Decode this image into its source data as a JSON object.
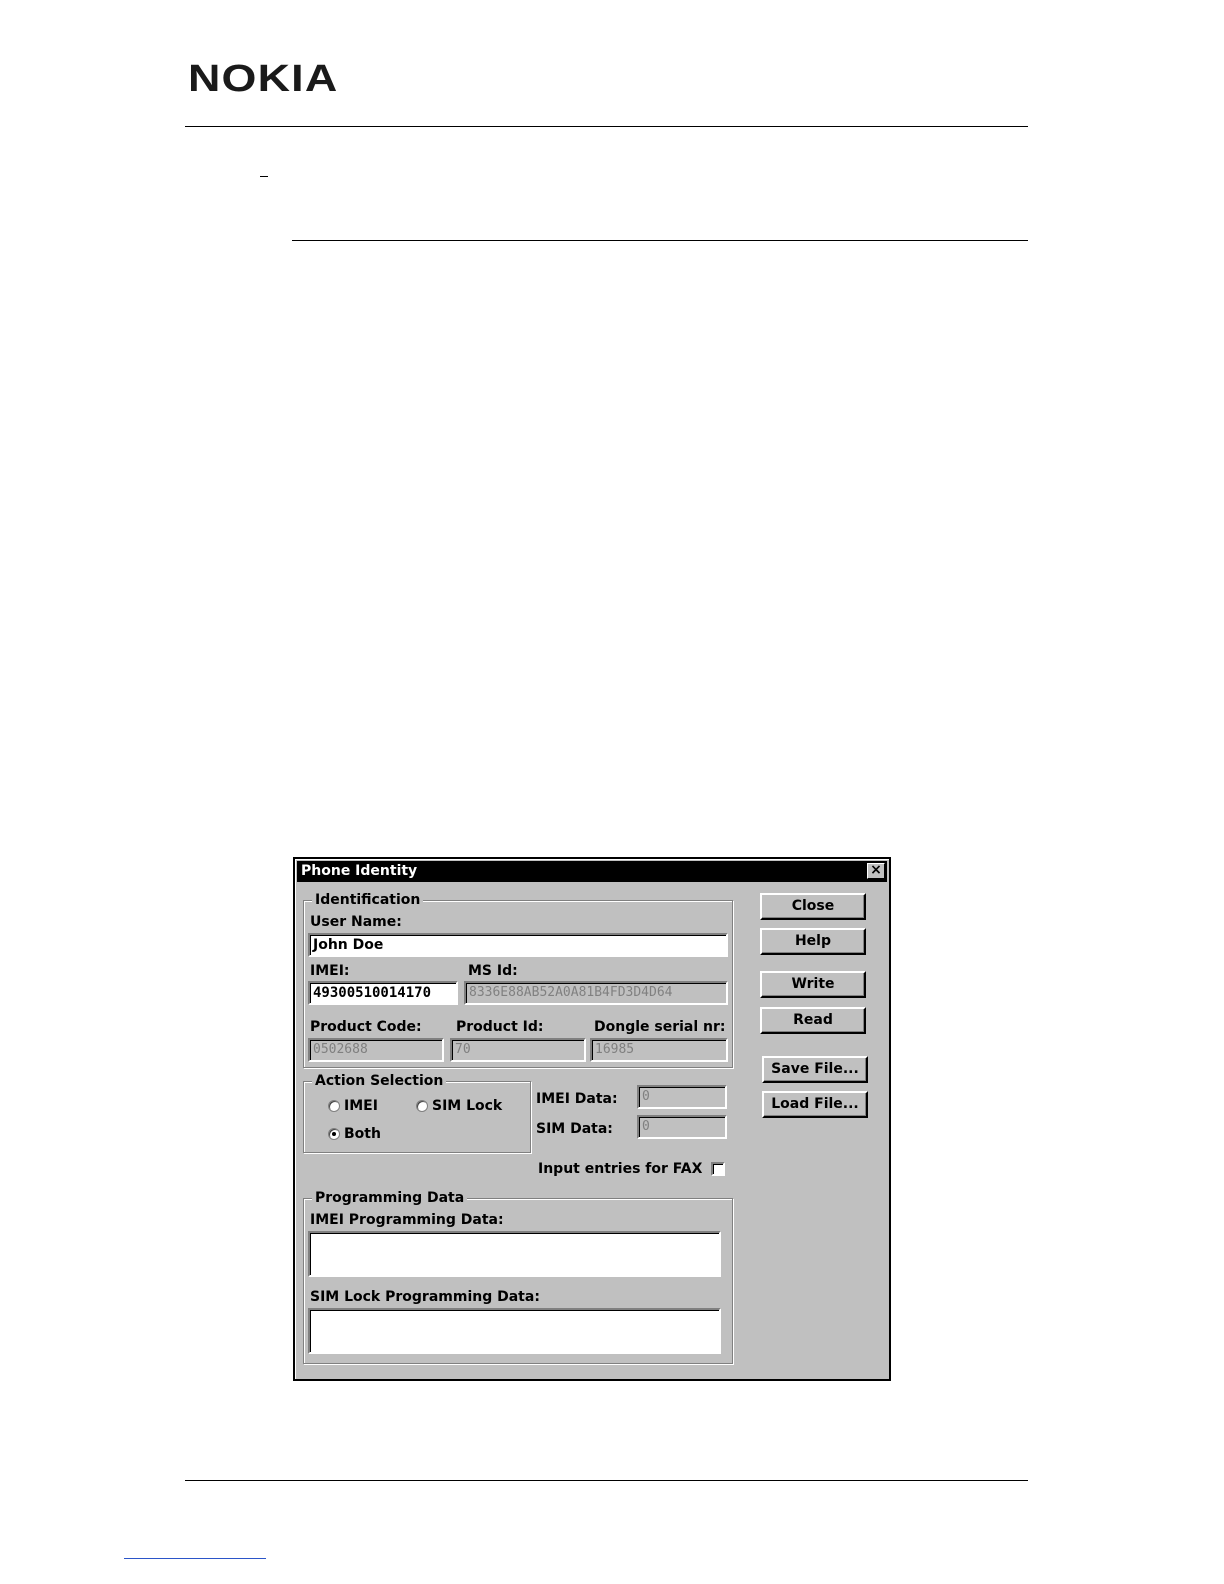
{
  "header": {
    "logo_text": "NOKIA"
  },
  "dialog": {
    "title": "Phone Identity",
    "close_glyph": "×",
    "identification": {
      "legend": "Identification",
      "user_name_label": "User Name:",
      "user_name_value": "John Doe",
      "imei_label": "IMEI:",
      "imei_value": "49300510014170",
      "ms_id_label": "MS Id:",
      "ms_id_value": "8336E88AB52A0A81B4FD3D4D64",
      "product_code_label": "Product Code:",
      "product_code_value": "0502688",
      "product_id_label": "Product Id:",
      "product_id_value": "70",
      "dongle_label": "Dongle serial nr:",
      "dongle_value": "16985"
    },
    "action_selection": {
      "legend": "Action Selection",
      "options": [
        "IMEI",
        "SIM Lock",
        "Both"
      ],
      "selected": "Both"
    },
    "imei_data_label": "IMEI Data:",
    "imei_data_value": "0",
    "sim_data_label": "SIM Data:",
    "sim_data_value": "0",
    "fax_label": "Input entries for FAX",
    "fax_checked": false,
    "programming": {
      "legend": "Programming Data",
      "imei_prog_label": "IMEI Programming Data:",
      "imei_prog_value": "",
      "sim_prog_label": "SIM Lock Programming Data:",
      "sim_prog_value": ""
    },
    "buttons": {
      "close": "Close",
      "help": "Help",
      "write": "Write",
      "read": "Read",
      "save_file": "Save File...",
      "load_file": "Load File..."
    }
  }
}
